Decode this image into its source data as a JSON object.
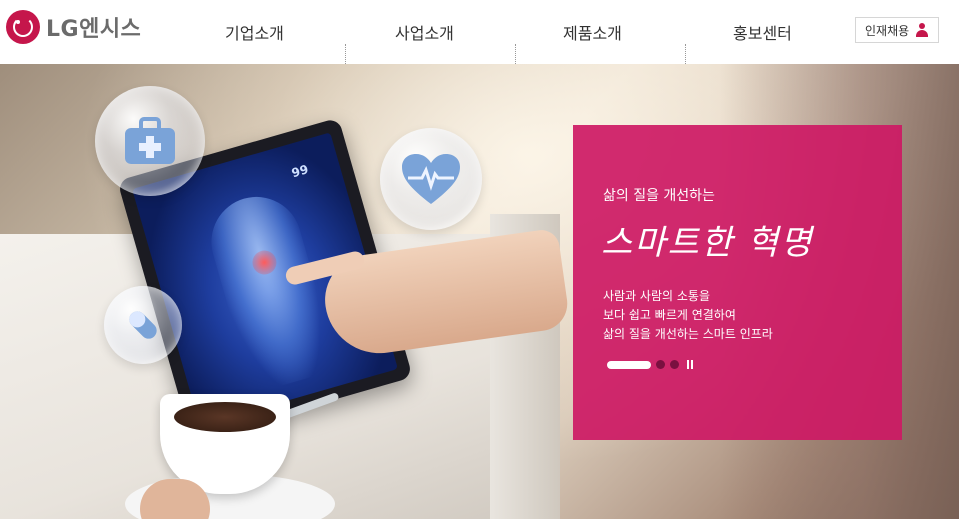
{
  "header": {
    "logo_text": "LG엔시스",
    "nav": [
      {
        "label": "기업소개"
      },
      {
        "label": "사업소개"
      },
      {
        "label": "제품소개"
      },
      {
        "label": "홍보센터"
      }
    ],
    "recruit_label": "인재채용"
  },
  "hero": {
    "tablet_reading": "99",
    "promo": {
      "subtitle": "삶의 질을 개선하는",
      "headline": "스마트한 혁명",
      "lines": [
        "사람과 사람의 소통을",
        "보다 쉽고 빠르게 연결하여",
        "삶의 질을 개선하는 스마트 인프라"
      ]
    },
    "slider": {
      "current_slide": 1,
      "total_slides": 3
    }
  },
  "colors": {
    "brand": "#c5164b",
    "promo_bg": "#cd1964",
    "text": "#333333"
  },
  "icons": [
    "lg-logo-icon",
    "person-icon",
    "medical-kit-icon",
    "heart-pulse-icon",
    "pill-icon",
    "pause-icon"
  ]
}
